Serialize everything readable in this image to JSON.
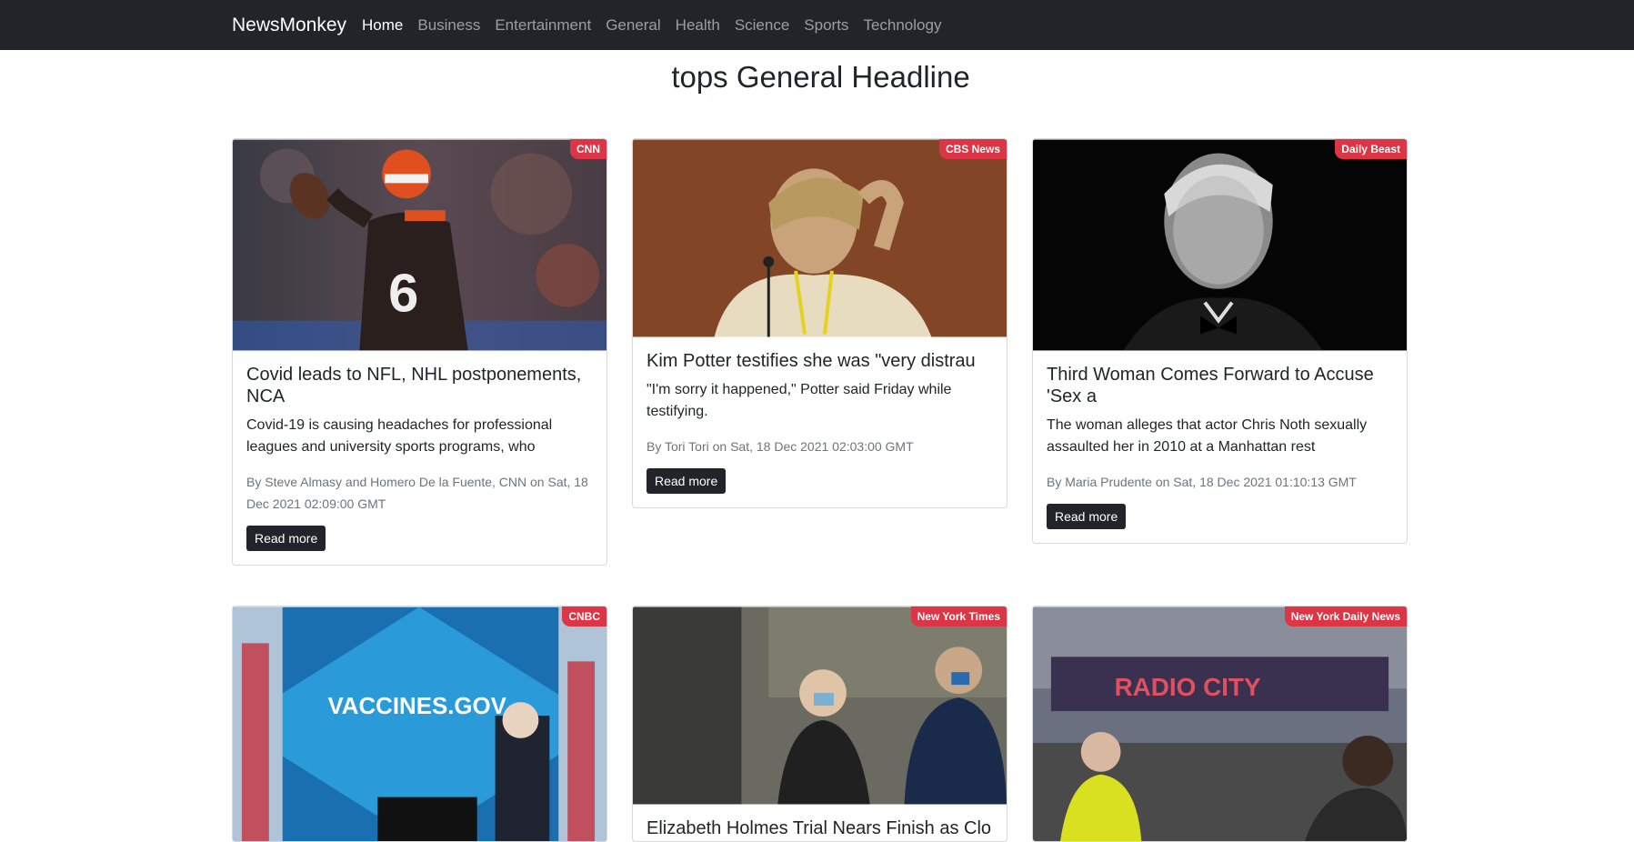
{
  "nav": {
    "brand": "NewsMonkey",
    "links": [
      "Home",
      "Business",
      "Entertainment",
      "General",
      "Health",
      "Science",
      "Sports",
      "Technology"
    ]
  },
  "page_title": "tops General Headline",
  "cards": [
    {
      "source": "CNN",
      "title": "Covid leads to NFL, NHL postponements, NCA",
      "description": "Covid-19 is causing headaches for professional leagues and university sports programs, who",
      "meta": "By Steve Almasy and Homero De la Fuente, CNN on Sat, 18 Dec 2021 02:09:00 GMT",
      "button": "Read more"
    },
    {
      "source": "CBS News",
      "title": "Kim Potter testifies she was \"very distrau",
      "description": "\"I'm sorry it happened,\" Potter said Friday while testifying.",
      "meta": "By Tori Tori on Sat, 18 Dec 2021 02:03:00 GMT",
      "button": "Read more"
    },
    {
      "source": "Daily Beast",
      "title": "Third Woman Comes Forward to Accuse 'Sex a",
      "description": "The woman alleges that actor Chris Noth sexually assaulted her in 2010 at a Manhattan rest",
      "meta": "By Maria Prudente on Sat, 18 Dec 2021 01:10:13 GMT",
      "button": "Read more"
    },
    {
      "source": "CNBC",
      "image_text": "VACCINES.GOV"
    },
    {
      "source": "New York Times",
      "title": "Elizabeth Holmes Trial Nears Finish as Clo"
    },
    {
      "source": "New York Daily News",
      "image_text": "RADIO CITY"
    }
  ],
  "colors": {
    "navbar": "#212529",
    "badge": "#dc3545",
    "button": "#212529"
  }
}
